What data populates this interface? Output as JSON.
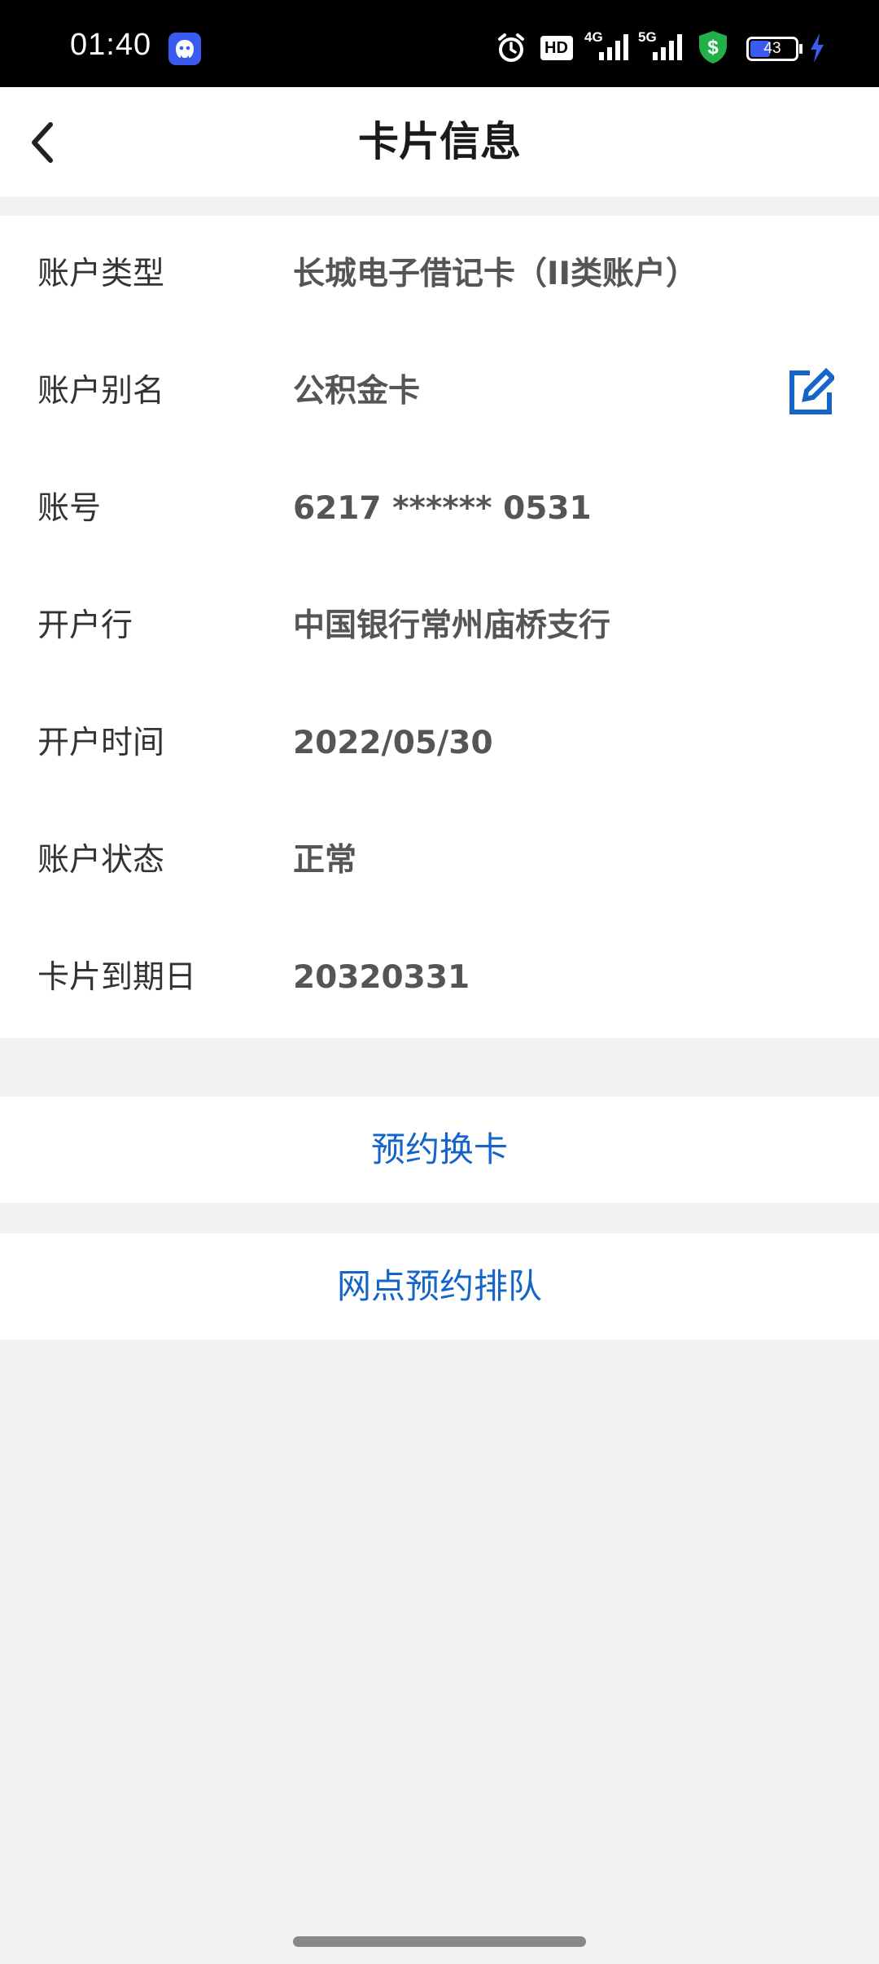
{
  "status_bar": {
    "time": "01:40",
    "battery": "43",
    "network_4g": "4G",
    "network_5g": "5G",
    "hd": "HD"
  },
  "header": {
    "title": "卡片信息"
  },
  "card_info": {
    "rows": [
      {
        "label": "账户类型",
        "value": "长城电子借记卡（II类账户）"
      },
      {
        "label": "账户别名",
        "value": "公积金卡"
      },
      {
        "label": "账号",
        "value": "6217 ****** 0531"
      },
      {
        "label": "开户行",
        "value": "中国银行常州庙桥支行"
      },
      {
        "label": "开户时间",
        "value": "2022/05/30"
      },
      {
        "label": "账户状态",
        "value": "正常"
      },
      {
        "label": "卡片到期日",
        "value": "20320331"
      }
    ]
  },
  "actions": {
    "replace_card": "预约换卡",
    "branch_queue": "网点预约排队"
  },
  "colors": {
    "accent": "#1565c9",
    "background": "#f2f2f2"
  }
}
